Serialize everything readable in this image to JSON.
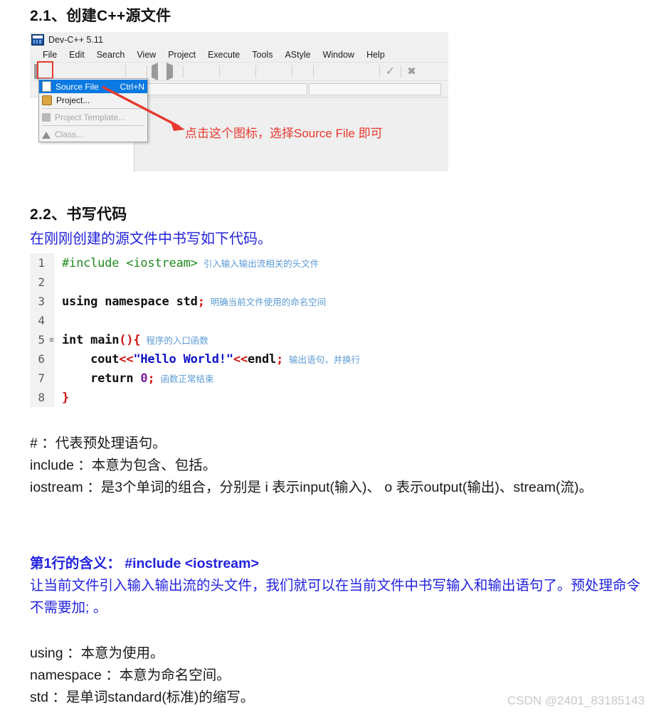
{
  "headings": {
    "sec_21": "2.1、创建C++源文件",
    "sec_22": "2.2、书写代码"
  },
  "devcpp": {
    "title": "Dev-C++ 5.11",
    "app_icon": "devcpp-app-icon",
    "menu": [
      {
        "label": "File"
      },
      {
        "label": "Edit"
      },
      {
        "label": "Search"
      },
      {
        "label": "View"
      },
      {
        "label": "Project"
      },
      {
        "label": "Execute"
      },
      {
        "label": "Tools"
      },
      {
        "label": "AStyle"
      },
      {
        "label": "Window"
      },
      {
        "label": "Help"
      }
    ],
    "dropdown": {
      "items": [
        {
          "label": "Source File",
          "shortcut": "Ctrl+N",
          "state": "selected",
          "icon": "page-icon"
        },
        {
          "label": "Project...",
          "shortcut": "",
          "state": "normal",
          "icon": "project-icon"
        },
        {
          "label": "Project Template...",
          "shortcut": "",
          "state": "disabled",
          "icon": "template-icon"
        },
        {
          "label": "Class...",
          "shortcut": "",
          "state": "disabled",
          "icon": "class-icon"
        }
      ]
    },
    "combo_value": ""
  },
  "annotation": {
    "red_note": "点击这个图标，选择Source File 即可",
    "arrow": "red-arrow"
  },
  "intro_blue": "在刚刚创建的源文件中书写如下代码。",
  "code": {
    "lines": [
      {
        "num": "1",
        "fold": "",
        "comment": "引入输入输出流相关的头文件"
      },
      {
        "num": "2",
        "fold": "",
        "comment": ""
      },
      {
        "num": "3",
        "fold": "",
        "comment": "明确当前文件使用的命名空间"
      },
      {
        "num": "4",
        "fold": "",
        "comment": ""
      },
      {
        "num": "5",
        "fold": "≡",
        "comment": "程序的入口函数"
      },
      {
        "num": "6",
        "fold": "",
        "comment": "输出语句，并换行"
      },
      {
        "num": "7",
        "fold": "",
        "comment": "函数正常结束"
      },
      {
        "num": "8",
        "fold": "",
        "comment": ""
      }
    ],
    "tokens": {
      "l1_include": "#include",
      "l1_header": "<iostream>",
      "l3_using": "using",
      "l3_namespace": "namespace",
      "l3_std": "std",
      "l3_semi": ";",
      "l5_int": "int",
      "l5_main": "main",
      "l5_parens": "(){",
      "l6_cout": "cout",
      "l6_op1": "<<",
      "l6_str": "\"Hello World!\"",
      "l6_op2": "<<",
      "l6_endl": "endl",
      "l6_semi": ";",
      "l7_return": "return",
      "l7_zero": "0",
      "l7_semi": ";",
      "l8_brace": "}"
    }
  },
  "explain1": {
    "line1": "# ：代表预处理语句。",
    "line2": "include ：本意为包含、包括。",
    "line3": "iostream ：是3个单词的组合，分别是 i 表示input(输入)、 o 表示output(输出)、stream(流)。"
  },
  "blue_block": {
    "title": "第1行的含义： #include <iostream>",
    "body": "让当前文件引入输入输出流的头文件，我们就可以在当前文件中书写输入和输出语句了。预处理命令不需要加; 。"
  },
  "explain2": {
    "line1": "using ：本意为使用。",
    "line2": "namespace ：本意为命名空间。",
    "line3": "std ：是单词standard(标准)的缩写。"
  },
  "watermark": "CSDN @2401_83185143",
  "colors": {
    "accent_red": "#e8392e",
    "accent_blue": "#2222dd",
    "menu_highlight": "#0a79e2",
    "comment_blue": "#5b9bd5",
    "code_green": "#1f8a1f",
    "code_red": "#d01212",
    "code_string": "#0f12c8"
  }
}
